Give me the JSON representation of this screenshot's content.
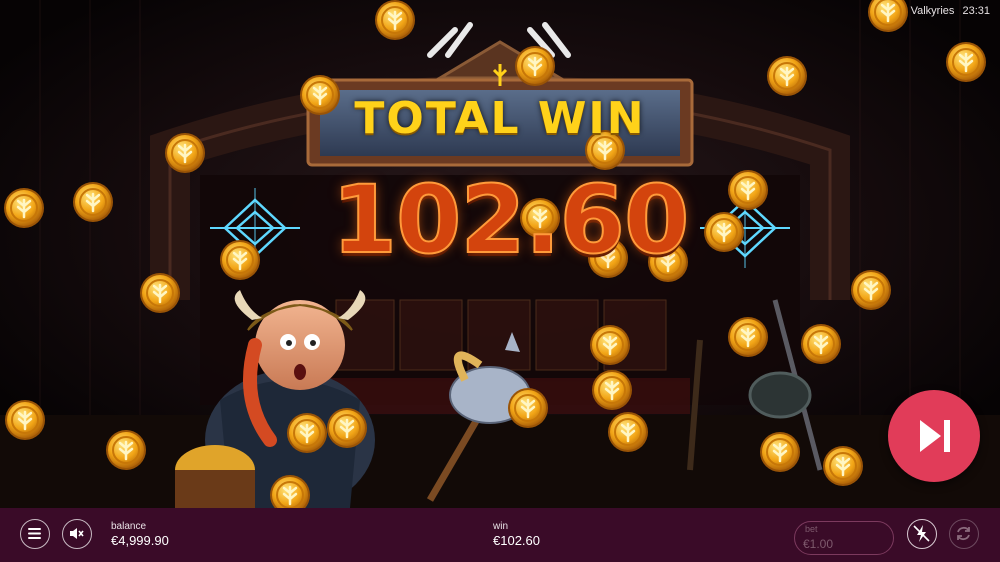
{
  "status": {
    "game_name": "Valkyries",
    "clock": "23:31"
  },
  "banner": {
    "title": "TOTAL WIN",
    "amount": "102.60"
  },
  "controls": {
    "balance_label": "balance",
    "balance_value": "€4,999.90",
    "win_label": "win",
    "win_value": "€102.60",
    "bet_label": "bet",
    "bet_value": "€1.00"
  },
  "icons": {
    "menu": "hamburger-menu-icon",
    "sound": "speaker-muted-icon",
    "turbo": "lightning-off-icon",
    "autoplay": "autoplay-icon",
    "skip": "skip-forward-icon"
  },
  "colors": {
    "bar_background": "#3a0b28",
    "skip_button": "#e13c59",
    "win_text": "#d3440d",
    "title_text": "#ffd21a"
  }
}
